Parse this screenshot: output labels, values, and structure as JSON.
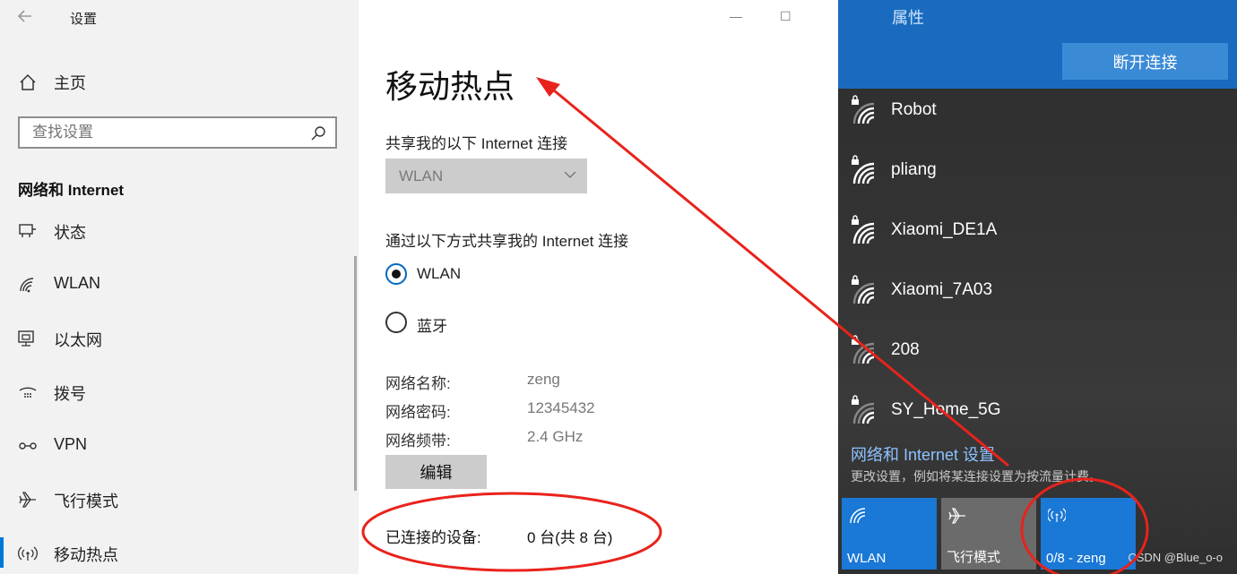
{
  "sidebar": {
    "app_title": "设置",
    "home_label": "主页",
    "search_placeholder": "查找设置",
    "section_title": "网络和 Internet",
    "items": [
      {
        "label": "状态",
        "icon": "status-icon"
      },
      {
        "label": "WLAN",
        "icon": "wifi-icon"
      },
      {
        "label": "以太网",
        "icon": "ethernet-icon"
      },
      {
        "label": "拨号",
        "icon": "dialup-icon"
      },
      {
        "label": "VPN",
        "icon": "vpn-icon"
      },
      {
        "label": "飞行模式",
        "icon": "airplane-icon"
      },
      {
        "label": "移动热点",
        "icon": "hotspot-icon",
        "active": true
      }
    ]
  },
  "main": {
    "title": "移动热点",
    "share_from_label": "共享我的以下 Internet 连接",
    "share_from_value": "WLAN",
    "share_via_label": "通过以下方式共享我的 Internet 连接",
    "via_options": [
      {
        "label": "WLAN",
        "checked": true
      },
      {
        "label": "蓝牙",
        "checked": false
      }
    ],
    "network_name_key": "网络名称:",
    "network_name_value": "zeng",
    "password_key": "网络密码:",
    "password_value": "12345432",
    "band_key": "网络频带:",
    "band_value": "2.4 GHz",
    "edit_label": "编辑",
    "connected_key": "已连接的设备:",
    "connected_value": "0 台(共 8 台)"
  },
  "window_controls": {
    "minimize": "—",
    "maximize": "☐"
  },
  "flyout": {
    "properties_label": "属性",
    "disconnect_label": "断开连接",
    "networks": [
      "Robot",
      "pliang",
      "Xiaomi_DE1A",
      "Xiaomi_7A03",
      "208",
      "SY_Home_5G"
    ],
    "settings_link": "网络和 Internet 设置",
    "settings_desc": "更改设置，例如将某连接设置为按流量计费。",
    "tiles": [
      {
        "label": "WLAN",
        "icon": "wifi-icon",
        "color": "#1a78d6"
      },
      {
        "label": "飞行模式",
        "icon": "airplane-icon",
        "color": "#6b6b6b"
      },
      {
        "label": "0/8 - zeng",
        "icon": "hotspot-icon",
        "color": "#1a78d6"
      }
    ]
  },
  "watermark": "CSDN @Blue_o-o",
  "colors": {
    "accent": "#0078d7",
    "annotation": "#e8231c"
  }
}
